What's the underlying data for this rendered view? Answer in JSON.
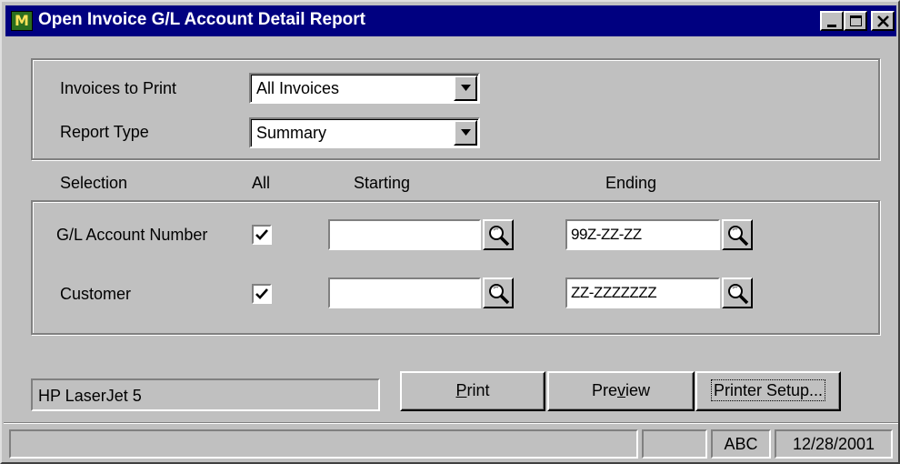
{
  "window": {
    "title": "Open Invoice G/L Account Detail Report",
    "app_icon_glyph": "M"
  },
  "options": {
    "invoices_to_print_label": "Invoices to Print",
    "invoices_to_print_value": "All Invoices",
    "report_type_label": "Report Type",
    "report_type_value": "Summary"
  },
  "selection_headers": {
    "selection": "Selection",
    "all": "All",
    "starting": "Starting",
    "ending": "Ending"
  },
  "rows": [
    {
      "label": "G/L Account Number",
      "all_checked": true,
      "starting": "",
      "ending": "99Z-ZZ-ZZ"
    },
    {
      "label": "Customer",
      "all_checked": true,
      "starting": "",
      "ending": "ZZ-ZZZZZZZ"
    }
  ],
  "printer": {
    "name": "HP LaserJet 5"
  },
  "buttons": {
    "print": {
      "pre": "",
      "mnemonic": "P",
      "post": "rint"
    },
    "preview": {
      "pre": "Pre",
      "mnemonic": "v",
      "post": "iew"
    },
    "printer_setup": "Printer Setup..."
  },
  "status": {
    "pane1": "",
    "pane2": "",
    "pane3": "ABC",
    "date": "12/28/2001"
  }
}
